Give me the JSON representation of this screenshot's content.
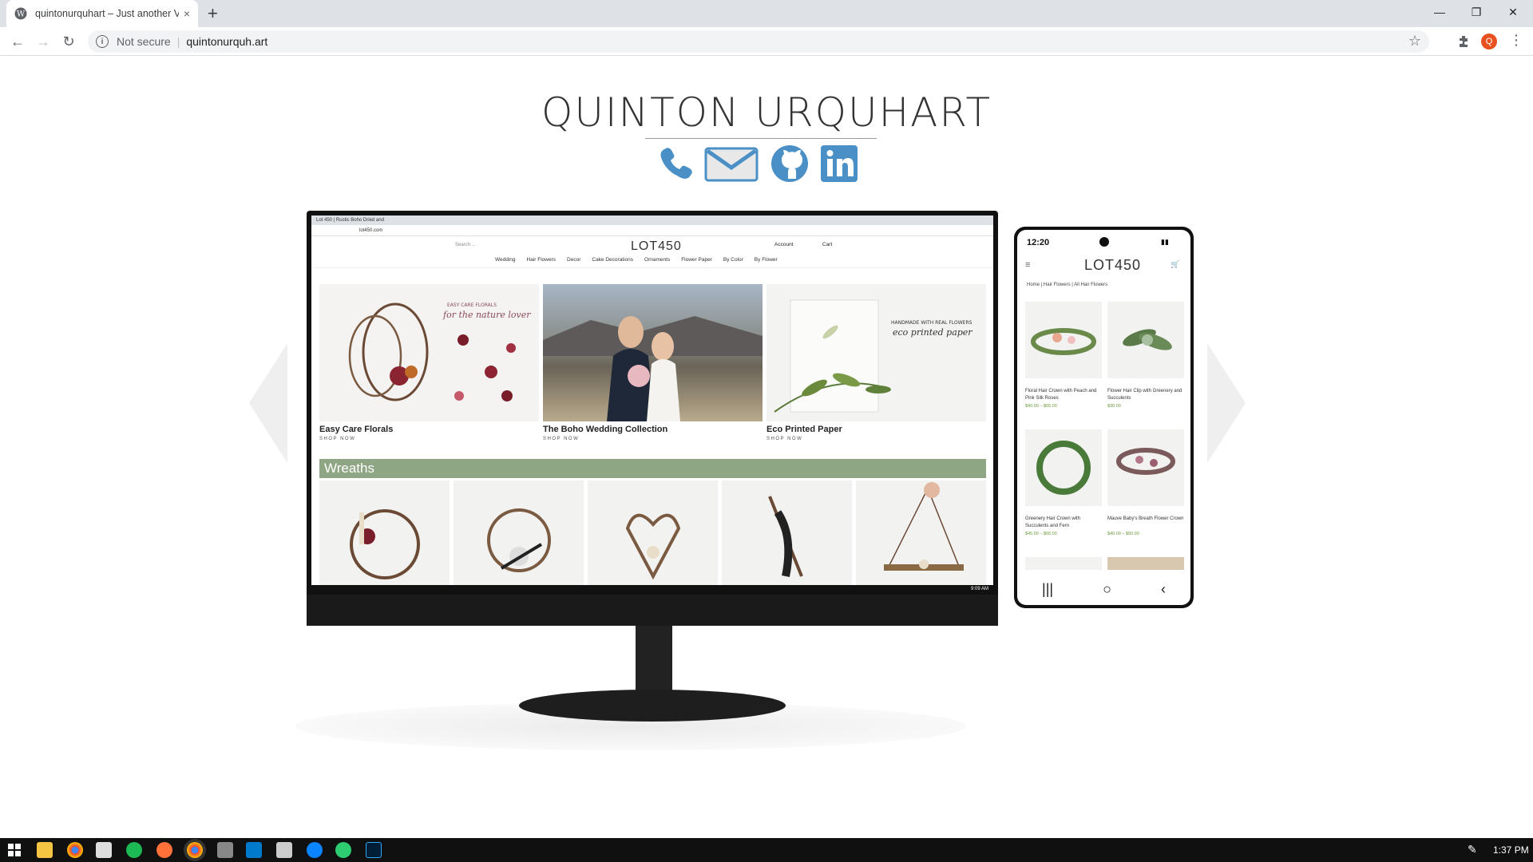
{
  "browser": {
    "tab_title": "quintonurquhart – Just another V",
    "new_tab": "+",
    "close_tab": "×",
    "not_secure": "Not secure",
    "url": "quintonurquh.art",
    "profile_initial": "Q"
  },
  "site": {
    "title": "QUINTON URQUHART",
    "social_icons": [
      "phone-icon",
      "mail-icon",
      "github-icon",
      "linkedin-icon"
    ],
    "accent_color": "#4a90c6"
  },
  "desktop_mock": {
    "tab_title": "Lot 450 | Rustic Boho Dried and",
    "url": "lot450.com",
    "search_placeholder": "Search ...",
    "logo": "LOT450",
    "account": "Account",
    "cart": "Cart",
    "nav": [
      "Wedding",
      "Hair Flowers",
      "Decor",
      "Cake Decorations",
      "Ornaments",
      "Flower Paper",
      "By Color",
      "By Flower"
    ],
    "heroes": [
      {
        "caption": "Easy Care Florals",
        "shop": "SHOP NOW",
        "overlay_top": "EASY CARE FLORALS",
        "overlay_script": "for the nature lover"
      },
      {
        "caption": "The Boho Wedding Collection",
        "shop": "SHOP NOW"
      },
      {
        "caption": "Eco Printed Paper",
        "shop": "SHOP NOW",
        "overlay_top": "HANDMADE WITH REAL FLOWERS",
        "overlay_script": "eco printed paper"
      }
    ],
    "section_title": "Wreaths",
    "taskbar_time": "9:09 AM"
  },
  "phone_mock": {
    "time": "12:20",
    "logo": "LOT450",
    "breadcrumb": "Home | Hair Flowers | All Hair Flowers",
    "products": [
      {
        "name": "Floral Hair Crown with Peach and Pink Silk Roses",
        "price": "$40.00 – $65.00"
      },
      {
        "name": "Flower Hair Clip with Greenery and Succulents",
        "price": "$30.00"
      },
      {
        "name": "Greenery Hair Crown with Succulents and Fern",
        "price": "$45.00 – $65.00"
      },
      {
        "name": "Mauve Baby's Breath Flower Crown",
        "price": "$40.00 – $50.00"
      }
    ]
  },
  "taskbar": {
    "clock": "1:37 PM"
  }
}
